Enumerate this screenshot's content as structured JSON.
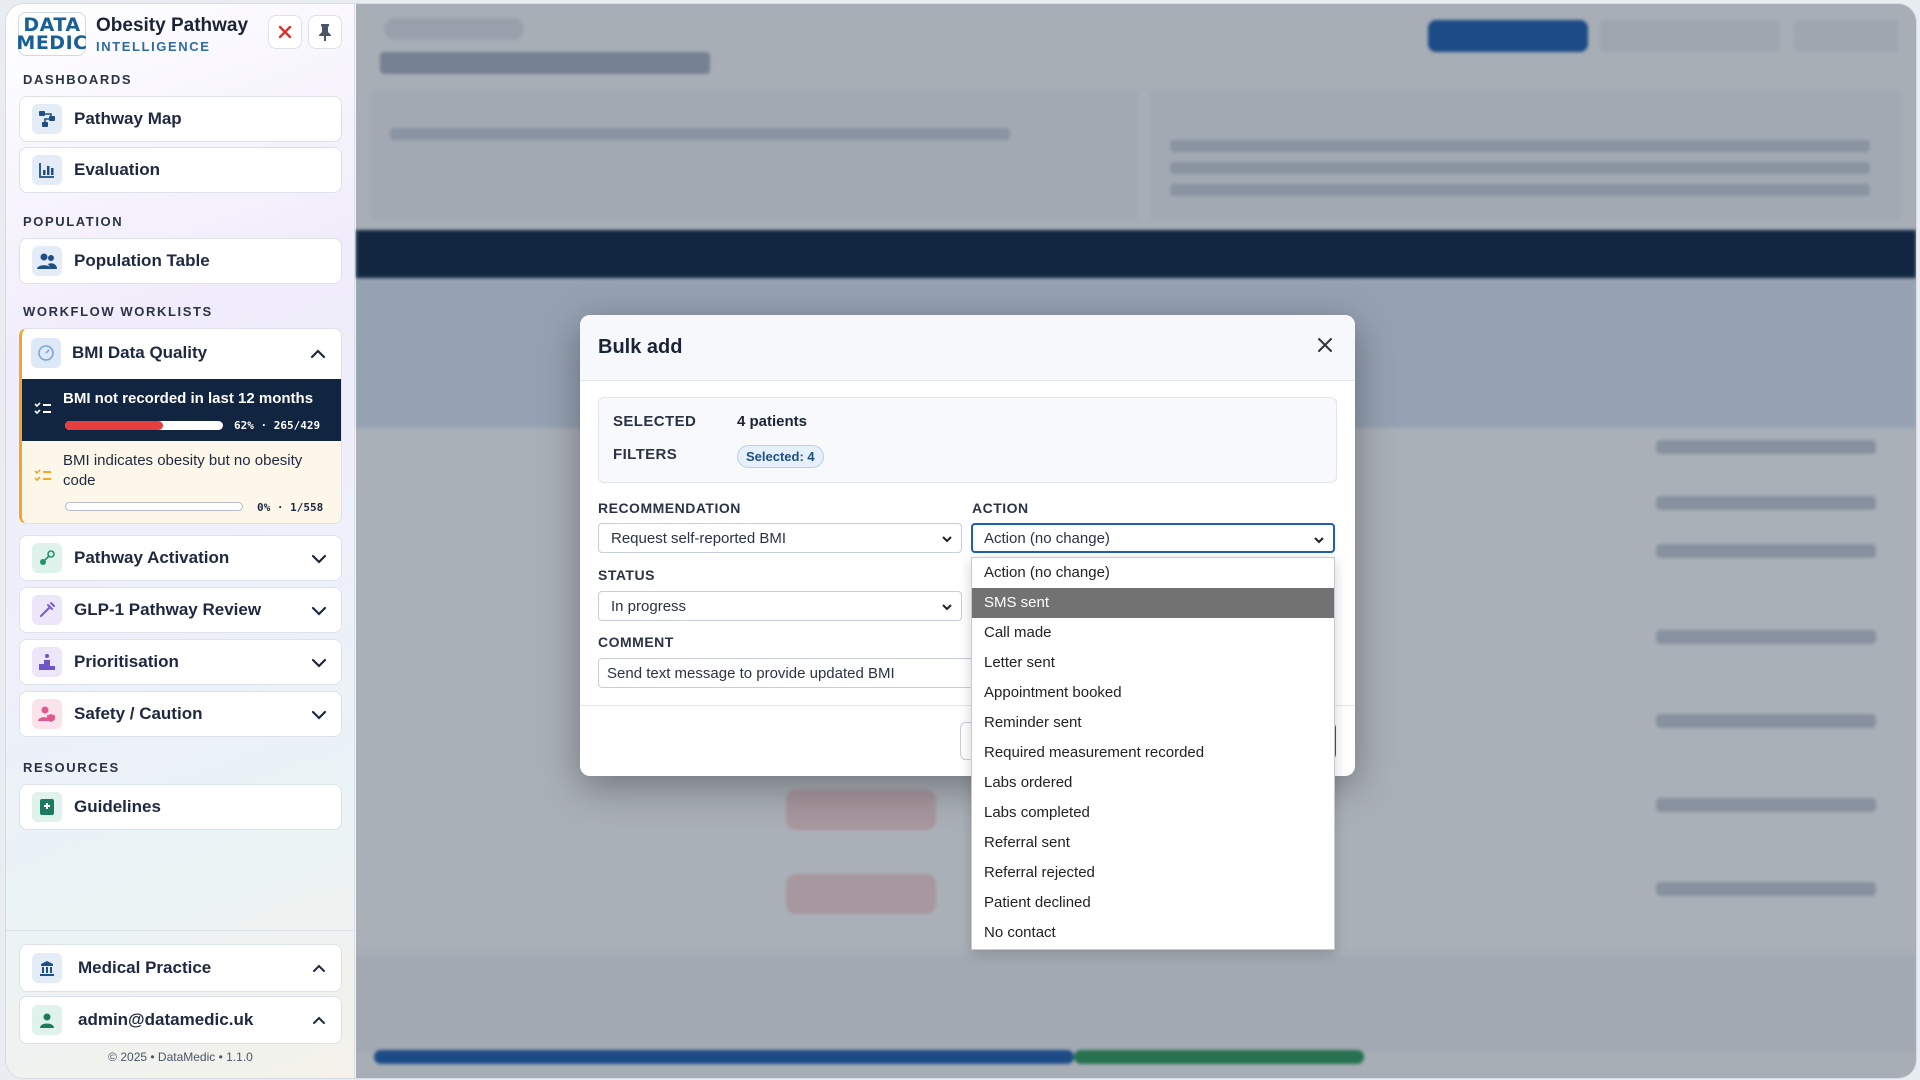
{
  "brand": {
    "logo_line1": "DATA",
    "logo_line2": "MEDIC",
    "title": "Obesity Pathway",
    "subtitle": "INTELLIGENCE"
  },
  "sidebar": {
    "dashboards_heading": "DASHBOARDS",
    "dashboards": [
      {
        "label": "Pathway Map"
      },
      {
        "label": "Evaluation"
      }
    ],
    "population_heading": "POPULATION",
    "population": [
      {
        "label": "Population Table"
      }
    ],
    "worklists_heading": "WORKFLOW WORKLISTS",
    "bmi_group": {
      "label": "BMI Data Quality",
      "items": [
        {
          "label": "BMI not recorded in last 12 months",
          "progress": 0.62,
          "stat": "62% · 265/429"
        },
        {
          "label": "BMI indicates obesity but no obesity code",
          "progress": 0.0,
          "stat": "0% · 1/558"
        }
      ]
    },
    "groups": [
      {
        "label": "Pathway Activation"
      },
      {
        "label": "GLP-1 Pathway Review"
      },
      {
        "label": "Prioritisation"
      },
      {
        "label": "Safety / Caution"
      }
    ],
    "resources_heading": "RESOURCES",
    "resources": [
      {
        "label": "Guidelines"
      }
    ],
    "practice": "Medical Practice",
    "user": "admin@datamedic.uk",
    "footer": "© 2025 • DataMedic • 1.1.0"
  },
  "modal": {
    "title": "Bulk add",
    "selected_label": "SELECTED",
    "selected_value": "4 patients",
    "filters_label": "FILTERS",
    "filters_chip": "Selected: 4",
    "recommendation_label": "RECOMMENDATION",
    "recommendation_value": "Request self-reported BMI",
    "action_label": "ACTION",
    "action_value": "Action (no change)",
    "status_label": "STATUS",
    "status_value": "In progress",
    "comment_label": "COMMENT",
    "comment_value": "Send text message to provide updated BMI"
  },
  "action_options": [
    "Action (no change)",
    "SMS sent",
    "Call made",
    "Letter sent",
    "Appointment booked",
    "Reminder sent",
    "Required measurement recorded",
    "Labs ordered",
    "Labs completed",
    "Referral sent",
    "Referral rejected",
    "Patient declined",
    "No contact"
  ],
  "action_selected_index": 1,
  "colors": {
    "navy": "#112440",
    "accent": "#f5a623",
    "progress_red": "#e53e3e",
    "highlight": "#727272"
  }
}
